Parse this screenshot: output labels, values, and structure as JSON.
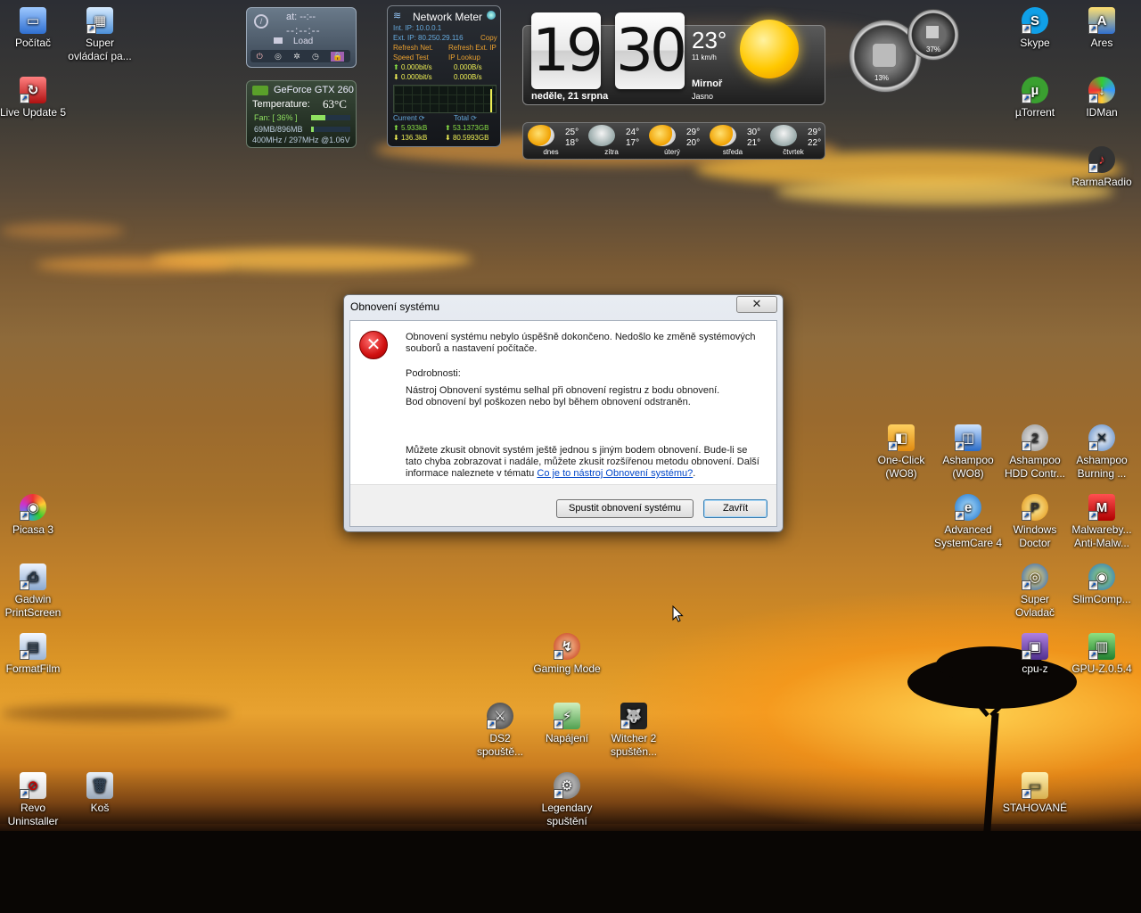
{
  "desktop_icons": {
    "pocitac": "Počítač",
    "super_ovladaci": "Super ovládací pa...",
    "live_update": "Live Update 5",
    "picasa": "Picasa 3",
    "gadwin": "Gadwin PrintScreen",
    "formatfilm": "FormatFilm",
    "revo": "Revo Uninstaller",
    "kos": "Koš",
    "skype": "Skype",
    "ares": "Ares",
    "utorrent": "µTorrent",
    "idman": "IDMan",
    "rarmaradio": "RarmaRadio",
    "oneclick": "One-Click (WO8)",
    "ashampoo_wo8": "Ashampoo (WO8)",
    "ashampoo_hdd": "Ashampoo HDD Contr...",
    "ashampoo_burning": "Ashampoo Burning ...",
    "advanced_systemcare": "Advanced SystemCare 4",
    "windows_doctor": "Windows Doctor",
    "malwarebytes": "Malwareby... Anti-Malw...",
    "super_ovladac": "Super Ovladač",
    "slimcomp": "SlimComp...",
    "cpuz": "cpu-z",
    "gpuz": "GPU-Z.0.5.4",
    "gaming_mode": "Gaming Mode",
    "ds2": "DS2 spouště...",
    "napajeni": "Napájení",
    "witcher2": "Witcher 2 spuštěn...",
    "legendary": "Legendary spuštění",
    "stahovane": "STAHOVANÉ"
  },
  "gadget_alarm": {
    "line1": "at:  --:--",
    "line2": "--:--:--",
    "load": "Load"
  },
  "gadget_gpu": {
    "name": "GeForce GTX 260",
    "temp_label": "Temperature:",
    "temp_value": "63°C",
    "fan": "Fan: [ 36% ]",
    "mem": "69MB/896MB",
    "clock": "400MHz / 297MHz @1.06V",
    "fan_pct": 0.36,
    "mem_pct": 0.077
  },
  "gadget_network": {
    "title": "Network Meter",
    "int_ip": "Int. IP:  10.0.0.1",
    "ext_ip": "Ext. IP:  80.250.29.116",
    "copy": "Copy",
    "refresh_net": "Refresh Net.",
    "refresh_ext": "Refresh Ext. IP",
    "speed_test": "Speed Test",
    "ip_lookup": "IP Lookup",
    "up1": "0.000bit/s",
    "up2": "0.000B/s",
    "down1": "0.000bit/s",
    "down2": "0.000B/s",
    "current": "Current",
    "total": "Total",
    "cur_up": "5.933kB",
    "cur_down": "136.3kB",
    "tot_up": "53.1373GB",
    "tot_down": "80.5993GB"
  },
  "gadget_clock": {
    "hour": "19",
    "minute": "30",
    "date": "neděle, 21 srpna",
    "temp": "23°",
    "wind": "11 km/h",
    "city": "Mirnoř",
    "cond": "Jasno"
  },
  "forecast": [
    {
      "day": "dnes",
      "hi": "25°",
      "lo": "18°"
    },
    {
      "day": "zítra",
      "hi": "24°",
      "lo": "17°"
    },
    {
      "day": "úterý",
      "hi": "29°",
      "lo": "20°"
    },
    {
      "day": "středa",
      "hi": "30°",
      "lo": "21°"
    },
    {
      "day": "čtvrtek",
      "hi": "29°",
      "lo": "22°"
    }
  ],
  "gadget_meter": {
    "cpu": "13%",
    "ram": "37%"
  },
  "dialog": {
    "title": "Obnovení systému",
    "close": "✕",
    "msg1": "Obnovení systému nebylo úspěšně dokončeno. Nedošlo ke změně systémových souborů a nastavení počítače.",
    "details_label": "Podrobnosti:",
    "details1": "Nástroj Obnovení systému selhal při obnovení registru z bodu obnovení.",
    "details2": "Bod obnovení byl poškozen nebo byl během obnovení odstraněn.",
    "msg2": "Můžete zkusit obnovit systém ještě jednou s jiným bodem obnovení. Bude-li se tato chyba zobrazovat i nadále, můžete zkusit rozšířenou metodu obnovení. Další informace naleznete v tématu",
    "link": "Co je to nástroj Obnovení systému?",
    "period": ".",
    "btn_run": "Spustit obnovení systému",
    "btn_close": "Zavřít"
  },
  "colors": {
    "accent_link": "#0046c8",
    "error_red": "#d01010",
    "gadget_green": "#8fe060"
  }
}
